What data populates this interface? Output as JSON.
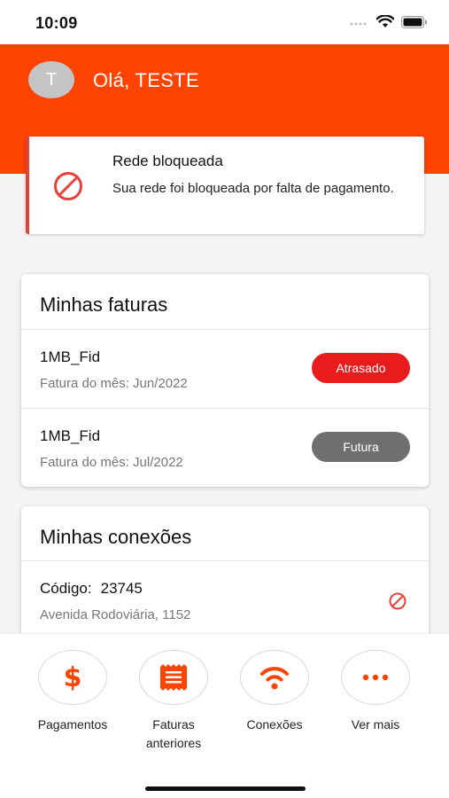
{
  "status_bar": {
    "time": "10:09"
  },
  "header": {
    "avatar_initial": "T",
    "greeting": "Olá, TESTE",
    "color": "#fe4402"
  },
  "alert": {
    "title": "Rede bloqueada",
    "message": "Sua rede foi bloqueada por falta de pagamento.",
    "icon": "blocked-icon",
    "color": "#e5413a"
  },
  "invoices": {
    "title": "Minhas faturas",
    "items": [
      {
        "plan": "1MB_Fid",
        "subtitle": "Fatura do mês: Jun/2022",
        "status": "Atrasado",
        "status_color": "#e81c1c"
      },
      {
        "plan": "1MB_Fid",
        "subtitle": "Fatura do mês: Jul/2022",
        "status": "Futura",
        "status_color": "#6f6f6f"
      }
    ]
  },
  "connections": {
    "title": "Minhas conexões",
    "items": [
      {
        "code_label": "Código:",
        "code": "23745",
        "address": "Avenida Rodoviária, 1152",
        "icon": "blocked-icon"
      }
    ]
  },
  "bottom_nav": {
    "items": [
      {
        "label": "Pagamentos",
        "icon": "dollar-icon",
        "glyph": "$"
      },
      {
        "label": "Faturas anteriores",
        "icon": "receipt-icon"
      },
      {
        "label": "Conexões",
        "icon": "wifi-icon"
      },
      {
        "label": "Ver mais",
        "icon": "more-dots-icon"
      }
    ]
  }
}
